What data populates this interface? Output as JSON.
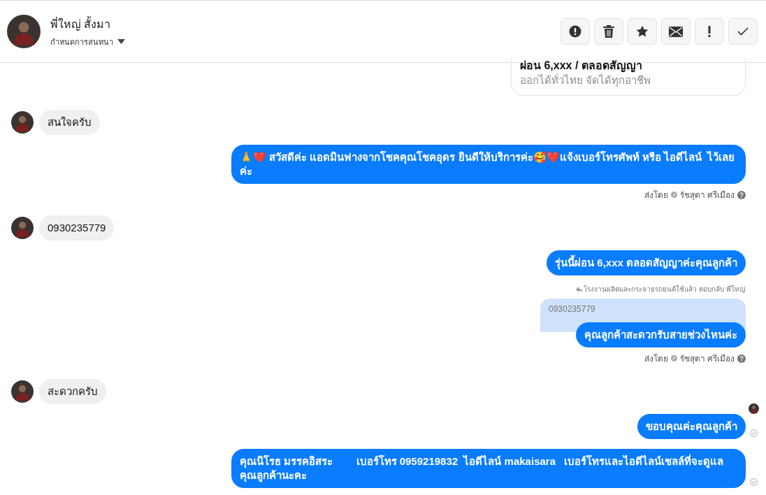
{
  "header": {
    "name": "พี่ใหญ่ สั้งมา",
    "subtitle": "กำหนดการสนทนา"
  },
  "messages": [
    {
      "kind": "card",
      "title": "ผ่อน 6,xxx / ตลอดสัญญา",
      "text": "ออกได้ทั่วไทย จัดได้ทุกอาชีพ"
    },
    {
      "kind": "incoming",
      "text": "สนใจครับ"
    },
    {
      "kind": "outgoing",
      "text": "🙏❤️ สวัสดีค่ะ แอดมินฟางจากโชคคุณโชคอุดร ยินดีให้บริการค่ะ🥰❤️แจ้งเบอร์โทรศัพท์ หรือ ไอดีไลน์  ไว้เลยค่ะ",
      "delivered": false
    },
    {
      "kind": "sent_by",
      "label": "ส่งโดย",
      "sender": "รัชสุดา ศรีเมือง"
    },
    {
      "kind": "incoming",
      "text": "0930235779"
    },
    {
      "kind": "outgoing",
      "text": "รุ่นนี้ผ่อน 6,xxx ตลอดสัญญาค่ะคุณลูกค้า",
      "delivered": false
    },
    {
      "kind": "reply",
      "label": "โรงงานผลิตและกระจายรถยนต์ใช้แล้ว ตอบกลับ พี่ใหญ่",
      "quote": "0930235779",
      "text": "คุณลูกค้าสะดวกรับสายช่วงไหนค่ะ"
    },
    {
      "kind": "sent_by",
      "label": "ส่งโดย",
      "sender": "รัชสุดา ศรีเมือง"
    },
    {
      "kind": "incoming",
      "text": "สะดวกครับ",
      "seen": true
    },
    {
      "kind": "outgoing",
      "text": "ขอบคุณค่ะคุณลูกค้า",
      "delivered": true
    },
    {
      "kind": "outgoing",
      "text": "คุณนิโรธ มรรคอิสระ        เบอร์โทร 0959219832  ไอดีไลน์ makaisara   เบอร์โทรและไอดีไลน์เชลล์ที่จะดูแลคุณลูกค้านะคะ",
      "delivered": true
    }
  ]
}
